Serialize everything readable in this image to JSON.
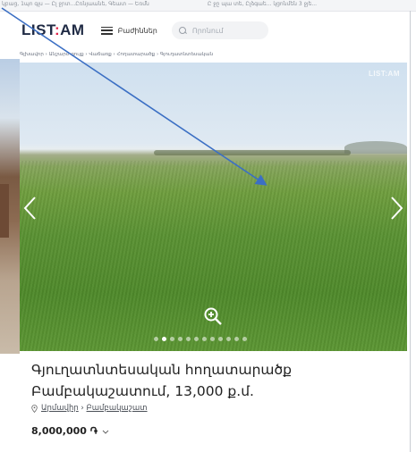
{
  "top_strip": {
    "left_text": "կբաց, 1պո գլս — Ըլ ջրտ...Ըռնյաանե, Գեատ — Եռմն",
    "right_text": "Ը ջը պա տե, Ըլձգաե... կցոնմեն 3 ջյե..."
  },
  "header": {
    "logo_left": "LIST",
    "logo_colon": ":",
    "logo_right": "AM",
    "menu_label": "Բաժիններ",
    "search_placeholder": "Որոնում"
  },
  "breadcrumb": "Գլխավոր › Անշարժ գույք › Վաճառք › Հողատարածք › Գյուղատնտեսական",
  "photo": {
    "watermark": "LIST:AM",
    "dot_count": 12,
    "active_dot": 1
  },
  "listing": {
    "title": "Գյուղատնտեսական հողատարածք Բամբակաշատում, 13,000 ք.մ.",
    "location_region": "Արմավիր",
    "location_sep": " › ",
    "location_city": "Բամբակաշատ",
    "price": "8,000,000 ֏"
  },
  "colors": {
    "brand_dark": "#1f2a44",
    "brand_red": "#e0244a",
    "annotation_arrow": "#3b6fc4"
  }
}
